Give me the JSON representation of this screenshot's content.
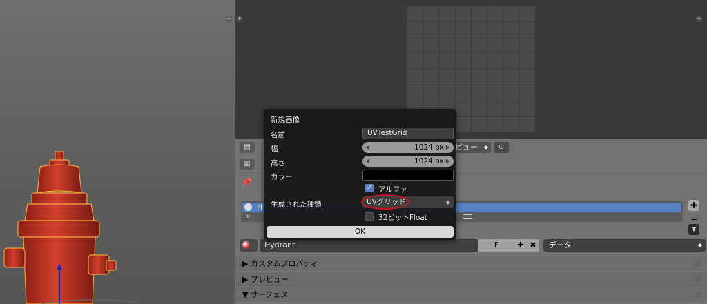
{
  "popup": {
    "title": "新規画像",
    "name_label": "名前",
    "name_value": "UVTestGrid",
    "width_label": "幅",
    "width_value": "1024 px",
    "height_label": "高さ",
    "height_value": "1024 px",
    "color_label": "カラー",
    "color_value": "#000000",
    "alpha_label": "アルファ",
    "alpha_checked": true,
    "generated_type_label": "生成された種類",
    "generated_type_value": "UVグリッド",
    "float_label": "32ビットFloat",
    "float_checked": false,
    "ok_label": "OK"
  },
  "uv_header": {
    "view_menu": "ビュー"
  },
  "properties": {
    "texture_item_prefix": "H",
    "material_name": "Hydrant",
    "fake_user": "F",
    "data_menu": "データ",
    "panels": [
      {
        "label": "カスタムプロパティ",
        "expanded": false
      },
      {
        "label": "プレビュー",
        "expanded": false
      },
      {
        "label": "サーフェス",
        "expanded": true
      }
    ]
  },
  "colors": {
    "selection_blue": "#5680c2",
    "highlight_red": "#c8141e",
    "hydrant_red": "#c0392b"
  }
}
